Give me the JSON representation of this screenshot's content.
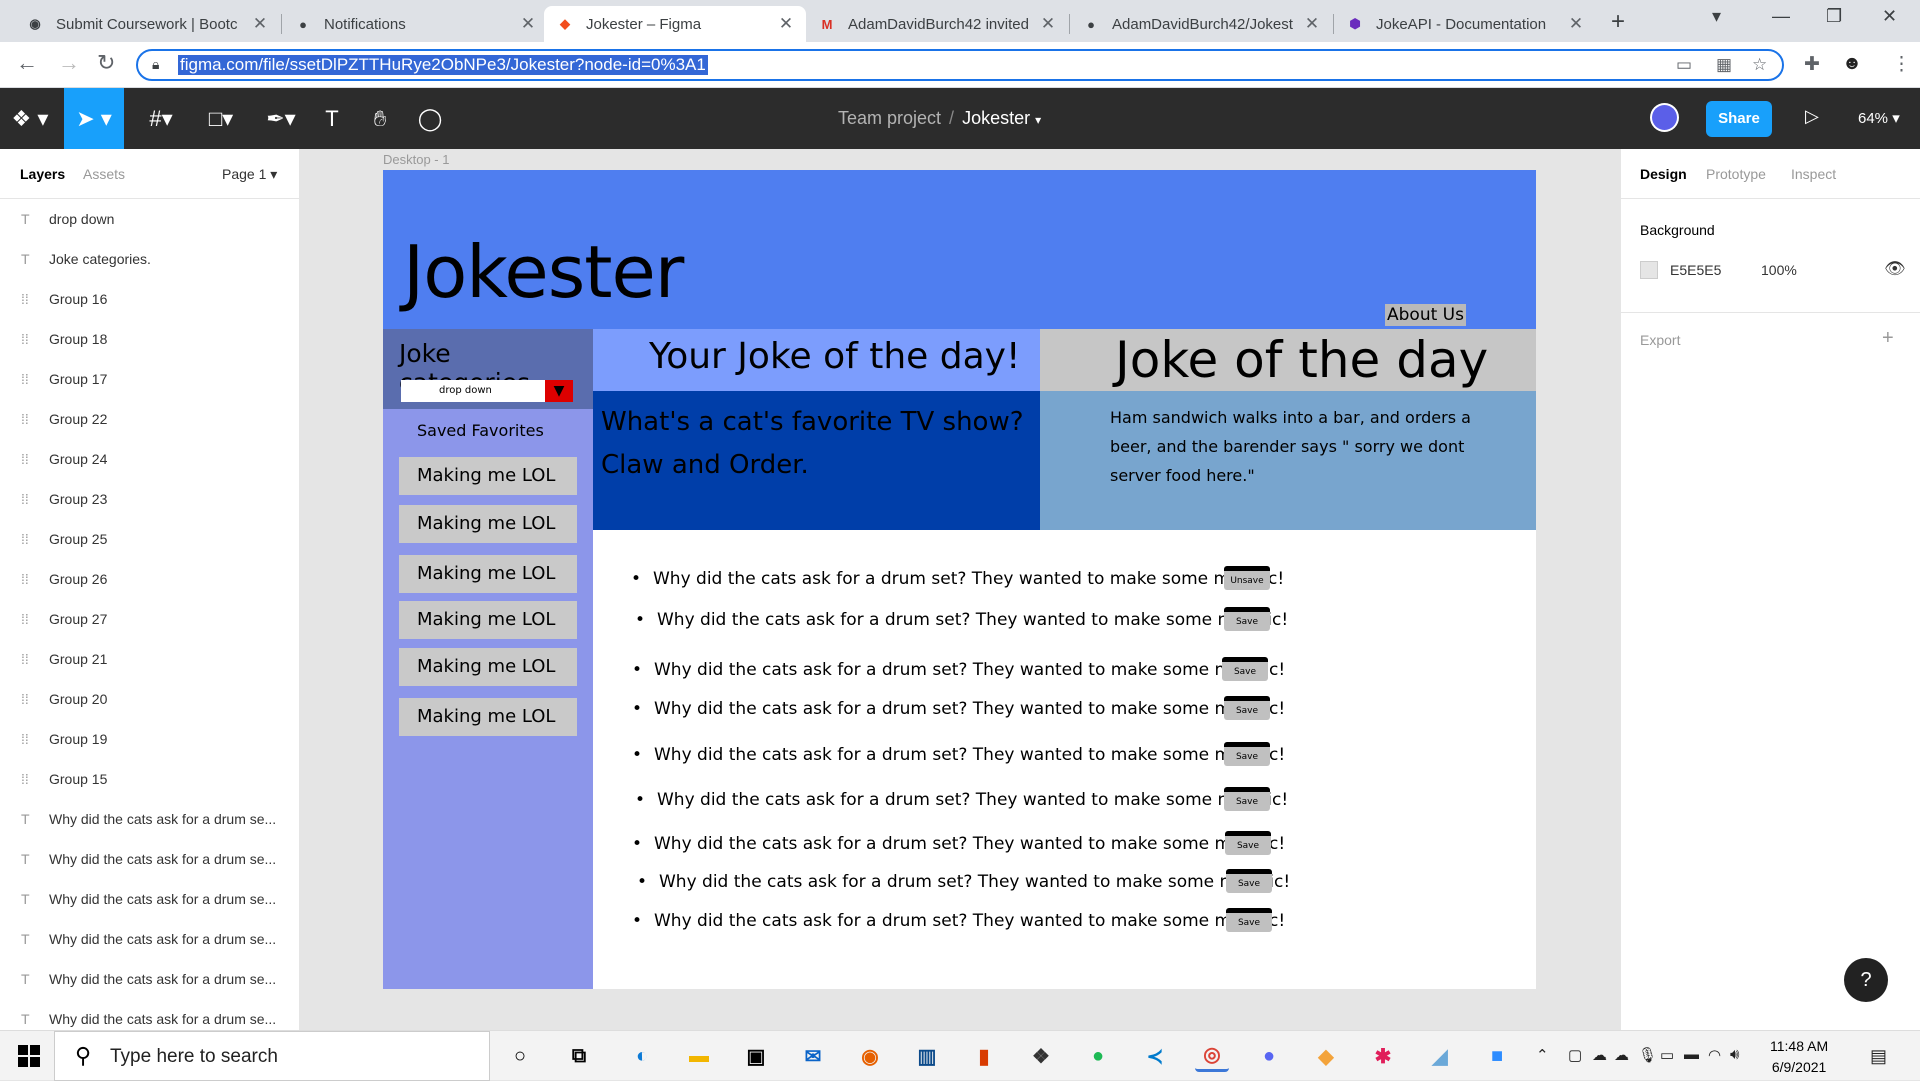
{
  "browser": {
    "tabs": [
      {
        "title": "Submit Coursework | Bootc",
        "icon": "globe-icon"
      },
      {
        "title": "Notifications",
        "icon": "github-icon"
      },
      {
        "title": "Jokester – Figma",
        "icon": "figma-icon"
      },
      {
        "title": "AdamDavidBurch42 invited",
        "icon": "gmail-icon"
      },
      {
        "title": "AdamDavidBurch42/Jokest",
        "icon": "github-icon"
      },
      {
        "title": "JokeAPI - Documentation",
        "icon": "jokeapi-icon"
      }
    ],
    "url": "figma.com/file/ssetDlPZTTHuRye2ObNPe3/Jokester?node-id=0%3A1"
  },
  "figma": {
    "breadcrumb_team": "Team project",
    "breadcrumb_sep": "/",
    "file_name": "Jokester",
    "share_label": "Share",
    "zoom": "64%",
    "left_tabs": {
      "layers": "Layers",
      "assets": "Assets",
      "page": "Page 1"
    },
    "layers": [
      {
        "type": "text",
        "name": "drop down"
      },
      {
        "type": "text",
        "name": "Joke categories."
      },
      {
        "type": "group",
        "name": "Group 16"
      },
      {
        "type": "group",
        "name": "Group 18"
      },
      {
        "type": "group",
        "name": "Group 17"
      },
      {
        "type": "group",
        "name": "Group 22"
      },
      {
        "type": "group",
        "name": "Group 24"
      },
      {
        "type": "group",
        "name": "Group 23"
      },
      {
        "type": "group",
        "name": "Group 25"
      },
      {
        "type": "group",
        "name": "Group 26"
      },
      {
        "type": "group",
        "name": "Group 27"
      },
      {
        "type": "group",
        "name": "Group 21"
      },
      {
        "type": "group",
        "name": "Group 20"
      },
      {
        "type": "group",
        "name": "Group 19"
      },
      {
        "type": "group",
        "name": "Group 15"
      },
      {
        "type": "text",
        "name": "Why did the cats ask for a drum se..."
      },
      {
        "type": "text",
        "name": "Why did the cats ask for a drum se..."
      },
      {
        "type": "text",
        "name": "Why did the cats ask for a drum se..."
      },
      {
        "type": "text",
        "name": "Why did the cats ask for a drum se..."
      },
      {
        "type": "text",
        "name": "Why did the cats ask for a drum se..."
      },
      {
        "type": "text",
        "name": "Why did the cats ask for a drum se..."
      }
    ],
    "frame_label": "Desktop - 1",
    "right_tabs": {
      "design": "Design",
      "prototype": "Prototype",
      "inspect": "Inspect"
    },
    "background_label": "Background",
    "background_hex": "E5E5E5",
    "background_opacity": "100%",
    "export_label": "Export"
  },
  "design": {
    "logo": "Jokester",
    "about": "About Us",
    "categories_title": "Joke categories.",
    "dropdown_label": "drop down",
    "saved_title": "Saved Favorites",
    "saved_items": [
      "Making me LOL",
      "Making me LOL",
      "Making me LOL",
      "Making me LOL",
      "Making me LOL",
      "Making me LOL"
    ],
    "your_joke_title": "Your Joke of the day!",
    "your_joke_q": "What's a cat's favorite TV show?",
    "your_joke_a": "Claw and Order.",
    "joke_day_title": "Joke of the day",
    "joke_day_text": "Ham sandwich walks into a bar, and orders a beer, and the barender says \" sorry we dont server food here.\"",
    "jokes": [
      {
        "text": "Why did the cats ask for a drum set? They wanted to make some mewsic!",
        "button": "Unsave"
      },
      {
        "text": "Why did the cats ask for a drum set? They wanted to make some mewsic!",
        "button": "Save"
      },
      {
        "text": "Why did the cats ask for a drum set? They wanted to make some mewsic!",
        "button": "Save"
      },
      {
        "text": "Why did the cats ask for a drum set? They wanted to make some mewsic!",
        "button": "Save"
      },
      {
        "text": "Why did the cats ask for a drum set? They wanted to make some mewsic!",
        "button": "Save"
      },
      {
        "text": "Why did the cats ask for a drum set? They wanted to make some mewsic!",
        "button": "Save"
      },
      {
        "text": "Why did the cats ask for a drum set? They wanted to make some mewsic!",
        "button": "Save"
      },
      {
        "text": "Why did the cats ask for a drum set? They wanted to make some mewsic!",
        "button": "Save"
      },
      {
        "text": "Why did the cats ask for a drum set? They wanted to make some mewsic!",
        "button": "Save"
      }
    ],
    "colors": {
      "hero": "#4f7ef0",
      "sidebar": "#8c96ea",
      "joke_body": "#003ea9",
      "joke_day_body": "#78a5ce",
      "accent": "#18a0fb"
    }
  },
  "taskbar": {
    "search_placeholder": "Type here to search",
    "time": "11:48 AM",
    "date": "6/9/2021"
  }
}
